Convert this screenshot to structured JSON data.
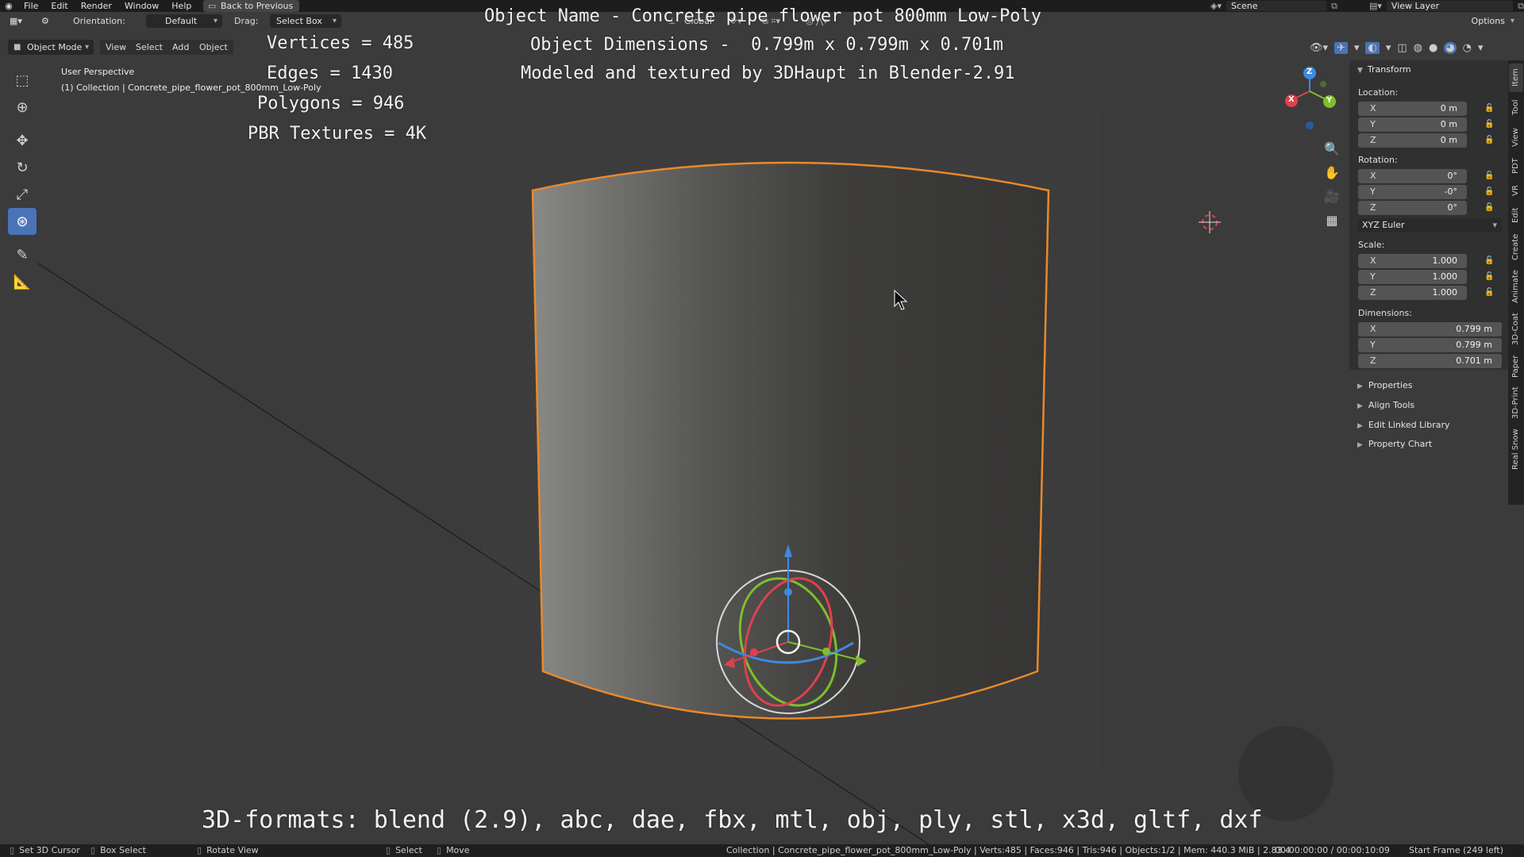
{
  "menubar": {
    "items": [
      "File",
      "Edit",
      "Render",
      "Window",
      "Help"
    ],
    "back_button": "Back to Previous",
    "scene": "Scene",
    "view_layer": "View Layer"
  },
  "header": {
    "orientation_label": "Orientation:",
    "orientation_value": "Default",
    "drag_label": "Drag:",
    "drag_value": "Select Box",
    "transform_space": "Global",
    "options": "Options"
  },
  "header3": {
    "mode": "Object Mode",
    "menus": [
      "View",
      "Select",
      "Add",
      "Object"
    ]
  },
  "viewport": {
    "perspective": "User Perspective",
    "collection": "(1) Collection | Concrete_pipe_flower_pot_800mm_Low-Poly",
    "stats": {
      "vertices": "Vertices = 485",
      "edges": "Edges = 1430",
      "polygons": "Polygons = 946",
      "textures": "PBR Textures = 4K"
    },
    "title_lines": [
      "Object Name - Concrete pipe flower pot 800mm Low-Poly",
      "Object Dimensions -  0.799m x 0.799m x 0.701m",
      "Modeled and textured by 3DHaupt in Blender-2.91"
    ],
    "formats": "3D-formats: blend (2.9), abc, dae, fbx, mtl, obj, ply, stl, x3d, gltf, dxf",
    "gizmo_axes": [
      "X",
      "Y",
      "Z"
    ]
  },
  "npanel": {
    "transform_title": "Transform",
    "location_label": "Location:",
    "location": [
      {
        "axis": "X",
        "value": "0 m"
      },
      {
        "axis": "Y",
        "value": "0 m"
      },
      {
        "axis": "Z",
        "value": "0 m"
      }
    ],
    "rotation_label": "Rotation:",
    "rotation": [
      {
        "axis": "X",
        "value": "0°"
      },
      {
        "axis": "Y",
        "value": "-0°"
      },
      {
        "axis": "Z",
        "value": "0°"
      }
    ],
    "rotation_mode": "XYZ Euler",
    "scale_label": "Scale:",
    "scale": [
      {
        "axis": "X",
        "value": "1.000"
      },
      {
        "axis": "Y",
        "value": "1.000"
      },
      {
        "axis": "Z",
        "value": "1.000"
      }
    ],
    "dimensions_label": "Dimensions:",
    "dimensions": [
      {
        "axis": "X",
        "value": "0.799 m"
      },
      {
        "axis": "Y",
        "value": "0.799 m"
      },
      {
        "axis": "Z",
        "value": "0.701 m"
      }
    ],
    "panels": [
      "Properties",
      "Align Tools",
      "Edit Linked Library",
      "Property Chart"
    ],
    "tabs": [
      "Item",
      "Tool",
      "View",
      "PDT",
      "VR",
      "Edit",
      "Create",
      "Animate",
      "3D-Coat",
      "Paper",
      "3D-Print",
      "Real Snow"
    ]
  },
  "statusbar": {
    "set_cursor": "Set 3D Cursor",
    "box_select": "Box Select",
    "rotate_view": "Rotate View",
    "select": "Select",
    "move": "Move",
    "info": "Collection | Concrete_pipe_flower_pot_800mm_Low-Poly | Verts:485 | Faces:946 | Tris:946 | Objects:1/2 | Mem: 440.3 MiB | 2.83.4",
    "time": "00:00:00:00 / 00:00:10:09",
    "frame": "Start Frame (249 left)"
  },
  "colors": {
    "selection_outline": "#e8892c",
    "accent_blue": "#4b73b8",
    "axis_x": "#e0404e",
    "axis_y": "#7fbf2a",
    "axis_z": "#3f8ae0"
  }
}
